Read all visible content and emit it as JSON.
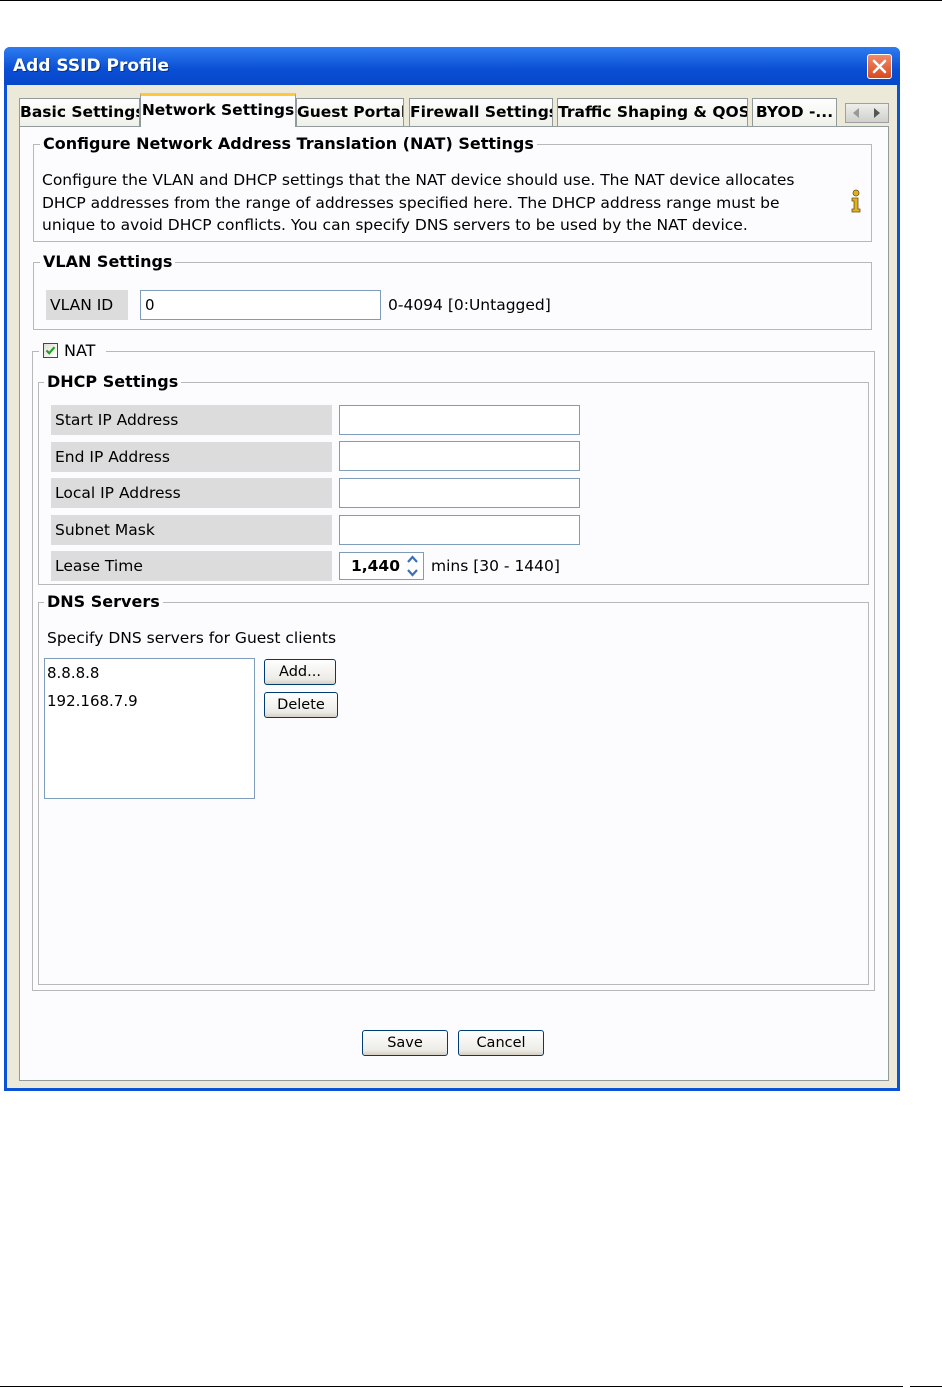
{
  "dialog": {
    "title": "Add SSID Profile"
  },
  "tabs": [
    {
      "label": "Basic Settings"
    },
    {
      "label": "Network Settings"
    },
    {
      "label": "Guest Portal"
    },
    {
      "label": "Firewall Settings"
    },
    {
      "label": "Traffic Shaping & QOS"
    },
    {
      "label": "BYOD -..."
    }
  ],
  "nat_config": {
    "legend": "Configure Network Address Translation (NAT) Settings",
    "description_lines": [
      "Configure the VLAN and DHCP settings that the NAT device should use. The NAT device allocates",
      "DHCP addresses from the range of addresses specified here. The DHCP address range must be",
      "unique to avoid DHCP conflicts. You can specify DNS servers to be used by the NAT device."
    ]
  },
  "vlan": {
    "legend": "VLAN Settings",
    "id_label": "VLAN ID",
    "id_value": "0",
    "range_hint": "0-4094 [0:Untagged]"
  },
  "nat": {
    "label": "NAT",
    "checked": true
  },
  "dhcp": {
    "legend": "DHCP Settings",
    "start_ip_label": "Start IP Address",
    "start_ip_value": "",
    "end_ip_label": "End IP Address",
    "end_ip_value": "",
    "local_ip_label": "Local IP Address",
    "local_ip_value": "",
    "subnet_label": "Subnet Mask",
    "subnet_value": "",
    "lease_label": "Lease Time",
    "lease_value": "1,440",
    "lease_hint": "mins [30 - 1440]"
  },
  "dns": {
    "legend": "DNS Servers",
    "instruction": "Specify DNS servers for Guest clients",
    "servers": [
      "8.8.8.8",
      "192.168.7.9"
    ],
    "add_label": "Add...",
    "delete_label": "Delete"
  },
  "footer": {
    "save_label": "Save",
    "cancel_label": "Cancel"
  },
  "colors": {
    "titlebar": "#0a53d6",
    "tab_active_accent": "#ffc83c",
    "dialog_bg": "#ece9d8"
  }
}
